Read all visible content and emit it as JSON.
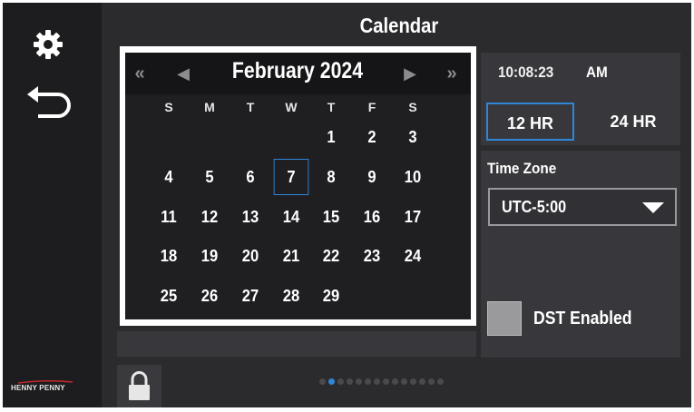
{
  "header": {
    "title": "Calendar"
  },
  "sidebar": {
    "settings_icon": "gear-icon",
    "back_icon": "back-arrow-icon",
    "brand": "HENNY PENNY"
  },
  "calendar": {
    "month_label": "February 2024",
    "nav": {
      "prev_year": "«",
      "prev_month": "◀",
      "next_month": "▶",
      "next_year": "»"
    },
    "weekdays": [
      "S",
      "M",
      "T",
      "W",
      "T",
      "F",
      "S"
    ],
    "weeks": [
      [
        "",
        "",
        "",
        "",
        "1",
        "2",
        "3"
      ],
      [
        "4",
        "5",
        "6",
        "7",
        "8",
        "9",
        "10"
      ],
      [
        "11",
        "12",
        "13",
        "14",
        "15",
        "16",
        "17"
      ],
      [
        "18",
        "19",
        "20",
        "21",
        "22",
        "23",
        "24"
      ],
      [
        "25",
        "26",
        "27",
        "28",
        "29",
        "",
        ""
      ]
    ],
    "selected_day": "7"
  },
  "clock": {
    "time": "10:08:23",
    "ampm": "AM",
    "format_12": "12 HR",
    "format_24": "24 HR",
    "selected_format": "12 HR"
  },
  "timezone": {
    "label": "Time Zone",
    "value": "UTC-5:00"
  },
  "dst": {
    "label": "DST Enabled",
    "checked": false
  },
  "footer": {
    "lock_icon": "lock-icon",
    "page_count": 14,
    "active_page": 2
  },
  "colors": {
    "accent": "#2f86d8",
    "background": "#2b2b2e",
    "sidebar": "#1d1d1f"
  }
}
